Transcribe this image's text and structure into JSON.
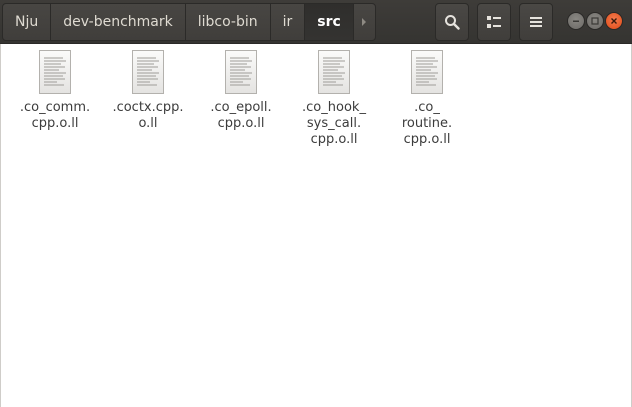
{
  "breadcrumbs": [
    {
      "label": "Nju",
      "active": false
    },
    {
      "label": "dev-benchmark",
      "active": false
    },
    {
      "label": "libco-bin",
      "active": false
    },
    {
      "label": "ir",
      "active": false
    },
    {
      "label": "src",
      "active": true
    }
  ],
  "toolbar": {
    "search_icon": "search-icon",
    "view_icon": "view-toggle-icon",
    "menu_icon": "hamburger-menu-icon"
  },
  "window_controls": {
    "minimize_icon": "minimize-icon",
    "maximize_icon": "maximize-icon",
    "close_icon": "close-icon"
  },
  "files": [
    {
      "name": ".co_comm.\ncpp.o.ll",
      "icon": "text-file-icon"
    },
    {
      "name": ".coctx.cpp.\no.ll",
      "icon": "text-file-icon"
    },
    {
      "name": ".co_epoll.\ncpp.o.ll",
      "icon": "text-file-icon"
    },
    {
      "name": ".co_hook_\nsys_call.\ncpp.o.ll",
      "icon": "text-file-icon"
    },
    {
      "name": ".co_\nroutine.\ncpp.o.ll",
      "icon": "text-file-icon"
    }
  ]
}
